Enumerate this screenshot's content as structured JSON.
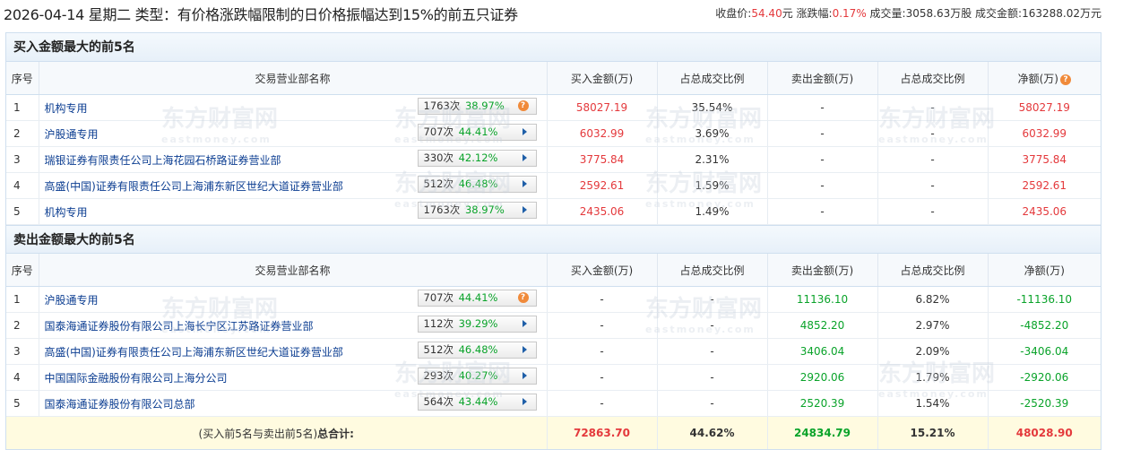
{
  "header": {
    "title": "2026-04-14 星期二 类型：有价格涨跌幅限制的日价格振幅达到15%的前五只证券",
    "close_label": "收盘价:",
    "close_value": "54.40",
    "close_unit": "元",
    "change_label": "涨跌幅:",
    "change_value": "0.17%",
    "volume_label": "成交量:",
    "volume_value": "3058.63万股",
    "amount_label": "成交金额:",
    "amount_value": "163288.02万元"
  },
  "columns": {
    "idx": "序号",
    "name": "交易营业部名称",
    "buy": "买入金额(万)",
    "buy_ratio": "占总成交比例",
    "sell": "卖出金额(万)",
    "sell_ratio": "占总成交比例",
    "net": "净额(万)"
  },
  "buy_section": {
    "title": "买入金额最大的前5名",
    "rows": [
      {
        "idx": "1",
        "name": "机构专用",
        "count": "1763次",
        "rate": "38.97%",
        "icon": "question-icon",
        "buy": "58027.19",
        "buy_ratio": "35.54%",
        "sell": "-",
        "sell_ratio": "-",
        "net": "58027.19"
      },
      {
        "idx": "2",
        "name": "沪股通专用",
        "count": "707次",
        "rate": "44.41%",
        "icon": "arrow-right-icon",
        "buy": "6032.99",
        "buy_ratio": "3.69%",
        "sell": "-",
        "sell_ratio": "-",
        "net": "6032.99"
      },
      {
        "idx": "3",
        "name": "瑞银证券有限责任公司上海花园石桥路证券营业部",
        "count": "330次",
        "rate": "42.12%",
        "icon": "arrow-right-icon",
        "buy": "3775.84",
        "buy_ratio": "2.31%",
        "sell": "-",
        "sell_ratio": "-",
        "net": "3775.84"
      },
      {
        "idx": "4",
        "name": "高盛(中国)证券有限责任公司上海浦东新区世纪大道证券营业部",
        "count": "512次",
        "rate": "46.48%",
        "icon": "arrow-right-icon",
        "buy": "2592.61",
        "buy_ratio": "1.59%",
        "sell": "-",
        "sell_ratio": "-",
        "net": "2592.61"
      },
      {
        "idx": "5",
        "name": "机构专用",
        "count": "1763次",
        "rate": "38.97%",
        "icon": "arrow-right-icon",
        "buy": "2435.06",
        "buy_ratio": "1.49%",
        "sell": "-",
        "sell_ratio": "-",
        "net": "2435.06"
      }
    ]
  },
  "sell_section": {
    "title": "卖出金额最大的前5名",
    "rows": [
      {
        "idx": "1",
        "name": "沪股通专用",
        "count": "707次",
        "rate": "44.41%",
        "icon": "question-icon",
        "buy": "-",
        "buy_ratio": "-",
        "sell": "11136.10",
        "sell_ratio": "6.82%",
        "net": "-11136.10"
      },
      {
        "idx": "2",
        "name": "国泰海通证券股份有限公司上海长宁区江苏路证券营业部",
        "count": "112次",
        "rate": "39.29%",
        "icon": "arrow-right-icon",
        "buy": "-",
        "buy_ratio": "-",
        "sell": "4852.20",
        "sell_ratio": "2.97%",
        "net": "-4852.20"
      },
      {
        "idx": "3",
        "name": "高盛(中国)证券有限责任公司上海浦东新区世纪大道证券营业部",
        "count": "512次",
        "rate": "46.48%",
        "icon": "arrow-right-icon",
        "buy": "-",
        "buy_ratio": "-",
        "sell": "3406.04",
        "sell_ratio": "2.09%",
        "net": "-3406.04"
      },
      {
        "idx": "4",
        "name": "中国国际金融股份有限公司上海分公司",
        "count": "293次",
        "rate": "40.27%",
        "icon": "arrow-right-icon",
        "buy": "-",
        "buy_ratio": "-",
        "sell": "2920.06",
        "sell_ratio": "1.79%",
        "net": "-2920.06"
      },
      {
        "idx": "5",
        "name": "国泰海通证券股份有限公司总部",
        "count": "564次",
        "rate": "43.44%",
        "icon": "arrow-right-icon",
        "buy": "-",
        "buy_ratio": "-",
        "sell": "2520.39",
        "sell_ratio": "1.54%",
        "net": "-2520.39"
      }
    ]
  },
  "total": {
    "label_pre": "(买入前5名与卖出前5名)",
    "label_bold": "总合计:",
    "buy": "72863.70",
    "buy_ratio": "44.62%",
    "sell": "24834.79",
    "sell_ratio": "15.21%",
    "net": "48028.90"
  },
  "watermark": {
    "text": "东方财富网",
    "sub": "eastmoney.com"
  },
  "colors": {
    "red": "#e4393c",
    "green": "#0aa32a",
    "link": "#0b3d91",
    "accent": "#f08a3a"
  }
}
